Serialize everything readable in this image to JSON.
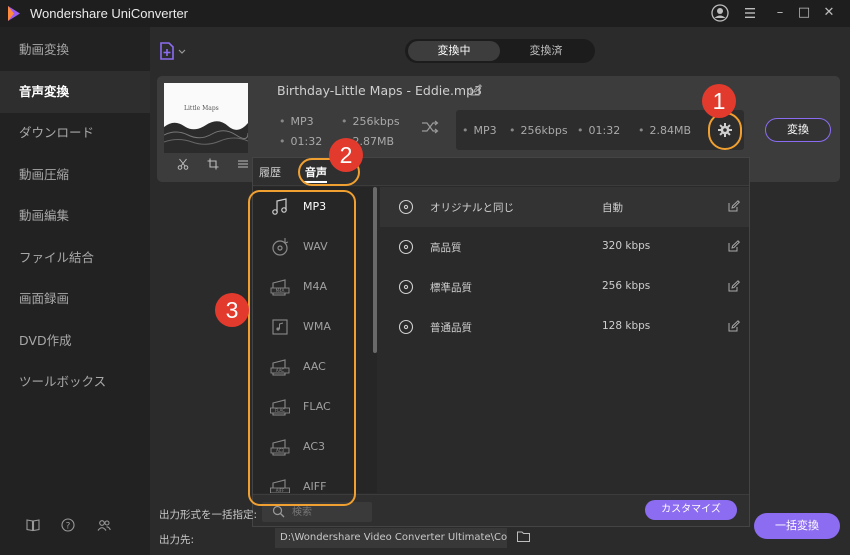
{
  "app": {
    "title": "Wondershare UniConverter"
  },
  "colors": {
    "accent": "#8c6cf0",
    "annotation_red": "#e23b2e",
    "annotation_ring": "#f0a030",
    "sidebar_bg": "#222222",
    "main_bg": "#2b2b2b"
  },
  "window_controls": {
    "account_icon": "account-icon",
    "menu_icon": "hamburger-menu-icon",
    "minimize": "–",
    "maximize": "□",
    "close": "✕"
  },
  "sidebar": {
    "items": [
      {
        "label": "動画変換",
        "active": false
      },
      {
        "label": "音声変換",
        "active": true
      },
      {
        "label": "ダウンロード",
        "active": false
      },
      {
        "label": "動画圧縮",
        "active": false
      },
      {
        "label": "動画編集",
        "active": false
      },
      {
        "label": "ファイル結合",
        "active": false
      },
      {
        "label": "画面録画",
        "active": false
      },
      {
        "label": "DVD作成",
        "active": false
      },
      {
        "label": "ツールボックス",
        "active": false
      }
    ],
    "footer_icons": [
      "book-icon",
      "help-icon",
      "users-icon"
    ]
  },
  "tabs": {
    "converting": "変換中",
    "converted": "変換済"
  },
  "file": {
    "thumbnail_caption": "Little Maps",
    "name": "Birthday-Little Maps - Eddie.mp3",
    "source": {
      "format": "MP3",
      "bitrate": "256kbps",
      "duration": "01:32",
      "size": "2.87MB"
    },
    "target": {
      "format": "MP3",
      "bitrate": "256kbps",
      "duration": "01:32",
      "size": "2.84MB"
    },
    "convert_label": "変換"
  },
  "format_panel": {
    "tabs": {
      "history": "履歴",
      "audio": "音声"
    },
    "formats": [
      {
        "label": "MP3",
        "icon": "music-note-icon",
        "selected": true
      },
      {
        "label": "WAV",
        "icon": "disc-icon",
        "selected": false
      },
      {
        "label": "M4A",
        "icon": "m4a-file-icon",
        "selected": false
      },
      {
        "label": "WMA",
        "icon": "wma-file-icon",
        "selected": false
      },
      {
        "label": "AAC",
        "icon": "aac-file-icon",
        "selected": false
      },
      {
        "label": "FLAC",
        "icon": "flac-file-icon",
        "selected": false
      },
      {
        "label": "AC3",
        "icon": "ac3-file-icon",
        "selected": false
      },
      {
        "label": "AIFF",
        "icon": "aiff-file-icon",
        "selected": false
      }
    ],
    "qualities": [
      {
        "name": "オリジナルと同じ",
        "rate": "自動",
        "selected": true
      },
      {
        "name": "高品質",
        "rate": "320 kbps",
        "selected": false
      },
      {
        "name": "標準品質",
        "rate": "256 kbps",
        "selected": false
      },
      {
        "name": "普通品質",
        "rate": "128 kbps",
        "selected": false
      }
    ],
    "search_placeholder": "検索",
    "customize_label": "カスタマイズ"
  },
  "bottom": {
    "output_format_label": "出力形式を一括指定:",
    "output_dir_label": "出力先:",
    "output_path": "D:\\Wondershare Video Converter Ultimate\\Co",
    "convert_all_label": "一括変換"
  },
  "annotations": [
    "1",
    "2",
    "3"
  ]
}
